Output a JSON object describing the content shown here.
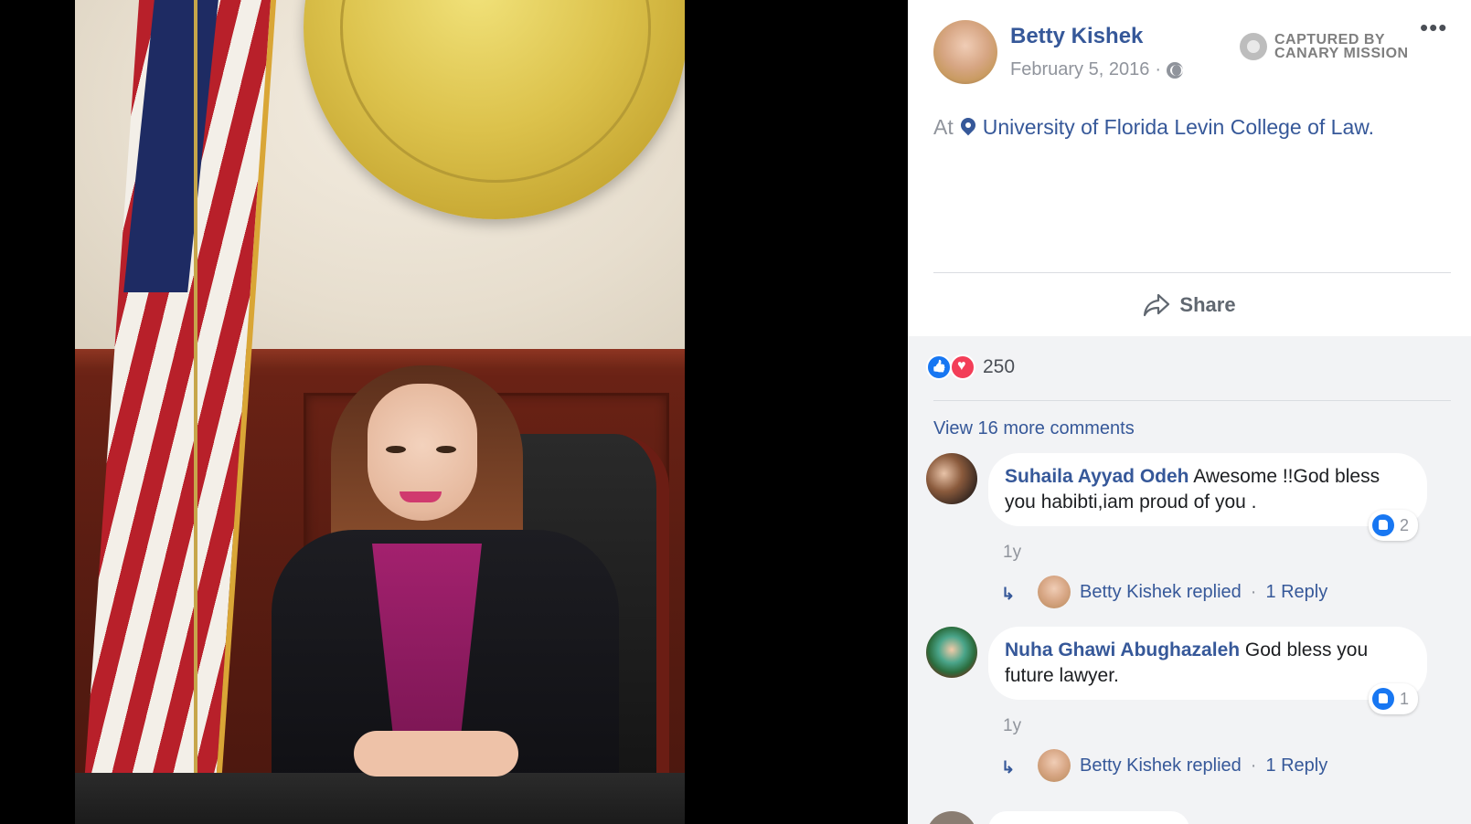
{
  "post": {
    "author": "Betty Kishek",
    "date": "February 5, 2016",
    "date_sep": "·",
    "privacy_icon": "globe-icon",
    "location_prefix": "At",
    "location": "University of Florida Levin College of Law.",
    "more_label": "•••"
  },
  "watermark": {
    "line1": "CAPTURED BY",
    "line2": "CANARY MISSION"
  },
  "actions": {
    "share_label": "Share"
  },
  "reactions": {
    "count": "250",
    "types": [
      "like",
      "love"
    ]
  },
  "comments_section": {
    "view_more": "View 16 more comments",
    "items": [
      {
        "author": "Suhaila Ayyad Odeh",
        "text": "Awesome !!God bless you habibti,iam proud of you .",
        "likes": "2",
        "time": "1y",
        "reply_by": "Betty Kishek replied",
        "reply_sep": "·",
        "reply_count": "1 Reply"
      },
      {
        "author": "Nuha Ghawi Abughazaleh",
        "text": "God bless you future lawyer.",
        "likes": "1",
        "time": "1y",
        "reply_by": "Betty Kishek replied",
        "reply_sep": "·",
        "reply_count": "1 Reply"
      }
    ]
  },
  "colors": {
    "link_blue": "#365899",
    "meta_gray": "#90949c",
    "like_blue": "#1877f2",
    "love_red": "#f33e58",
    "comments_bg": "#f2f3f5"
  }
}
